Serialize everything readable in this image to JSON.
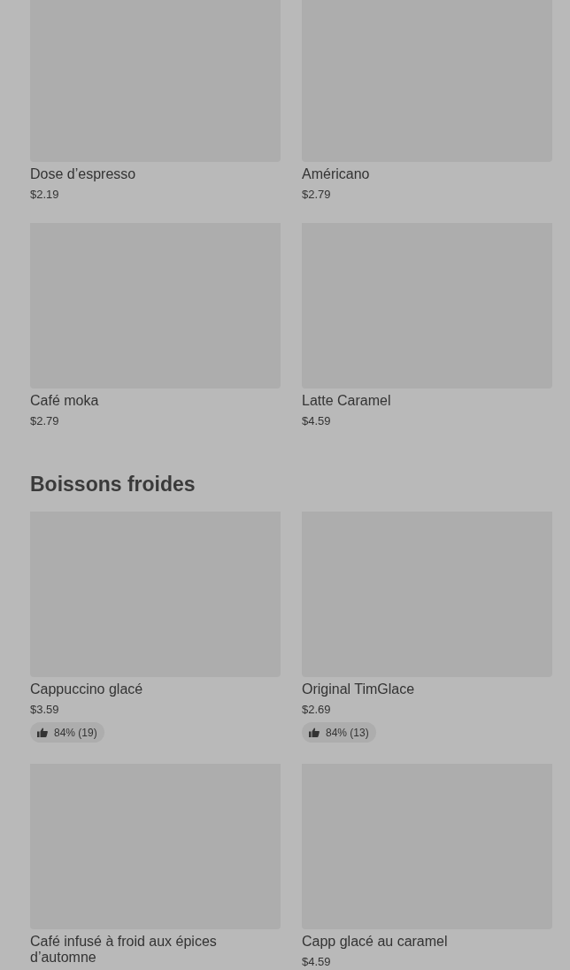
{
  "sections": [
    {
      "items": [
        {
          "name": "Dose d’espresso",
          "price": "$2.19"
        },
        {
          "name": "Américano",
          "price": "$2.79"
        },
        {
          "name": "Café moka",
          "price": "$2.79"
        },
        {
          "name": "Latte Caramel",
          "price": "$4.59"
        }
      ]
    },
    {
      "title": "Boissons froides",
      "items": [
        {
          "name": "Cappuccino glacé",
          "price": "$3.59",
          "rating": "84% (19)"
        },
        {
          "name": "Original TimGlace",
          "price": "$2.69",
          "rating": "84% (13)"
        },
        {
          "name": "Café infusé à froid aux épices d’automne"
        },
        {
          "name": "Capp glacé au caramel",
          "price": "$4.59"
        }
      ]
    }
  ]
}
